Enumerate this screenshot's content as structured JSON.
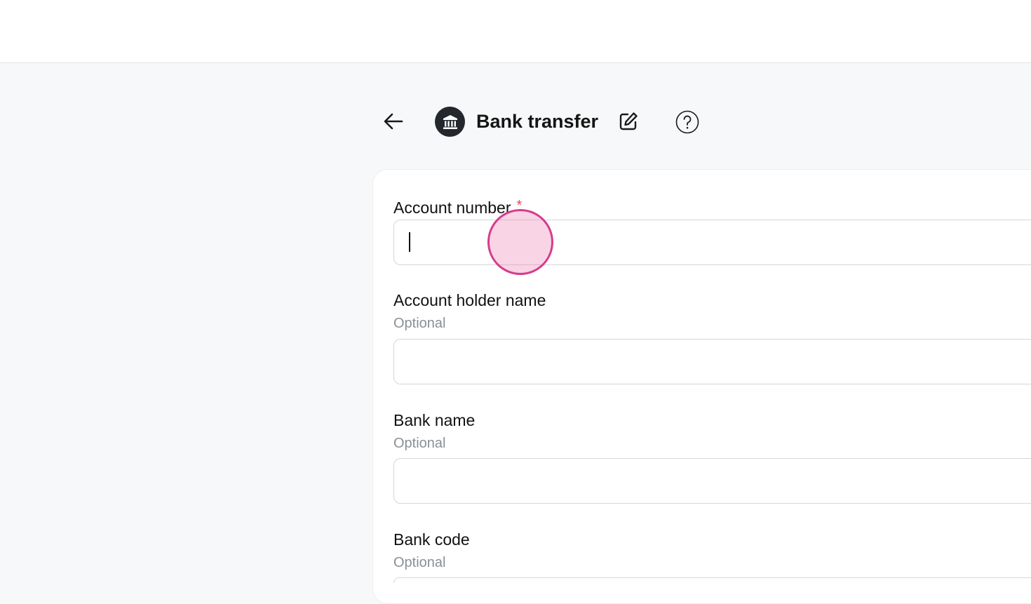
{
  "header": {
    "title": "Bank transfer",
    "back_icon": "arrow-left-icon",
    "method_icon": "bank-icon",
    "edit_icon": "pencil-square-icon",
    "help_icon": "question-circle-icon"
  },
  "form": {
    "fields": [
      {
        "label": "Account number",
        "required": true,
        "required_mark": "*",
        "hint": "",
        "value": ""
      },
      {
        "label": "Account holder name",
        "required": false,
        "hint": "Optional",
        "value": ""
      },
      {
        "label": "Bank name",
        "required": false,
        "hint": "Optional",
        "value": ""
      },
      {
        "label": "Bank code",
        "required": false,
        "hint": "Optional",
        "value": ""
      }
    ]
  },
  "colors": {
    "background": "#f7f8f9",
    "card": "#ffffff",
    "required": "#e5484d",
    "hint": "#8a8f96",
    "avatar": "#24282d",
    "click_marker": "#d63c8c"
  }
}
